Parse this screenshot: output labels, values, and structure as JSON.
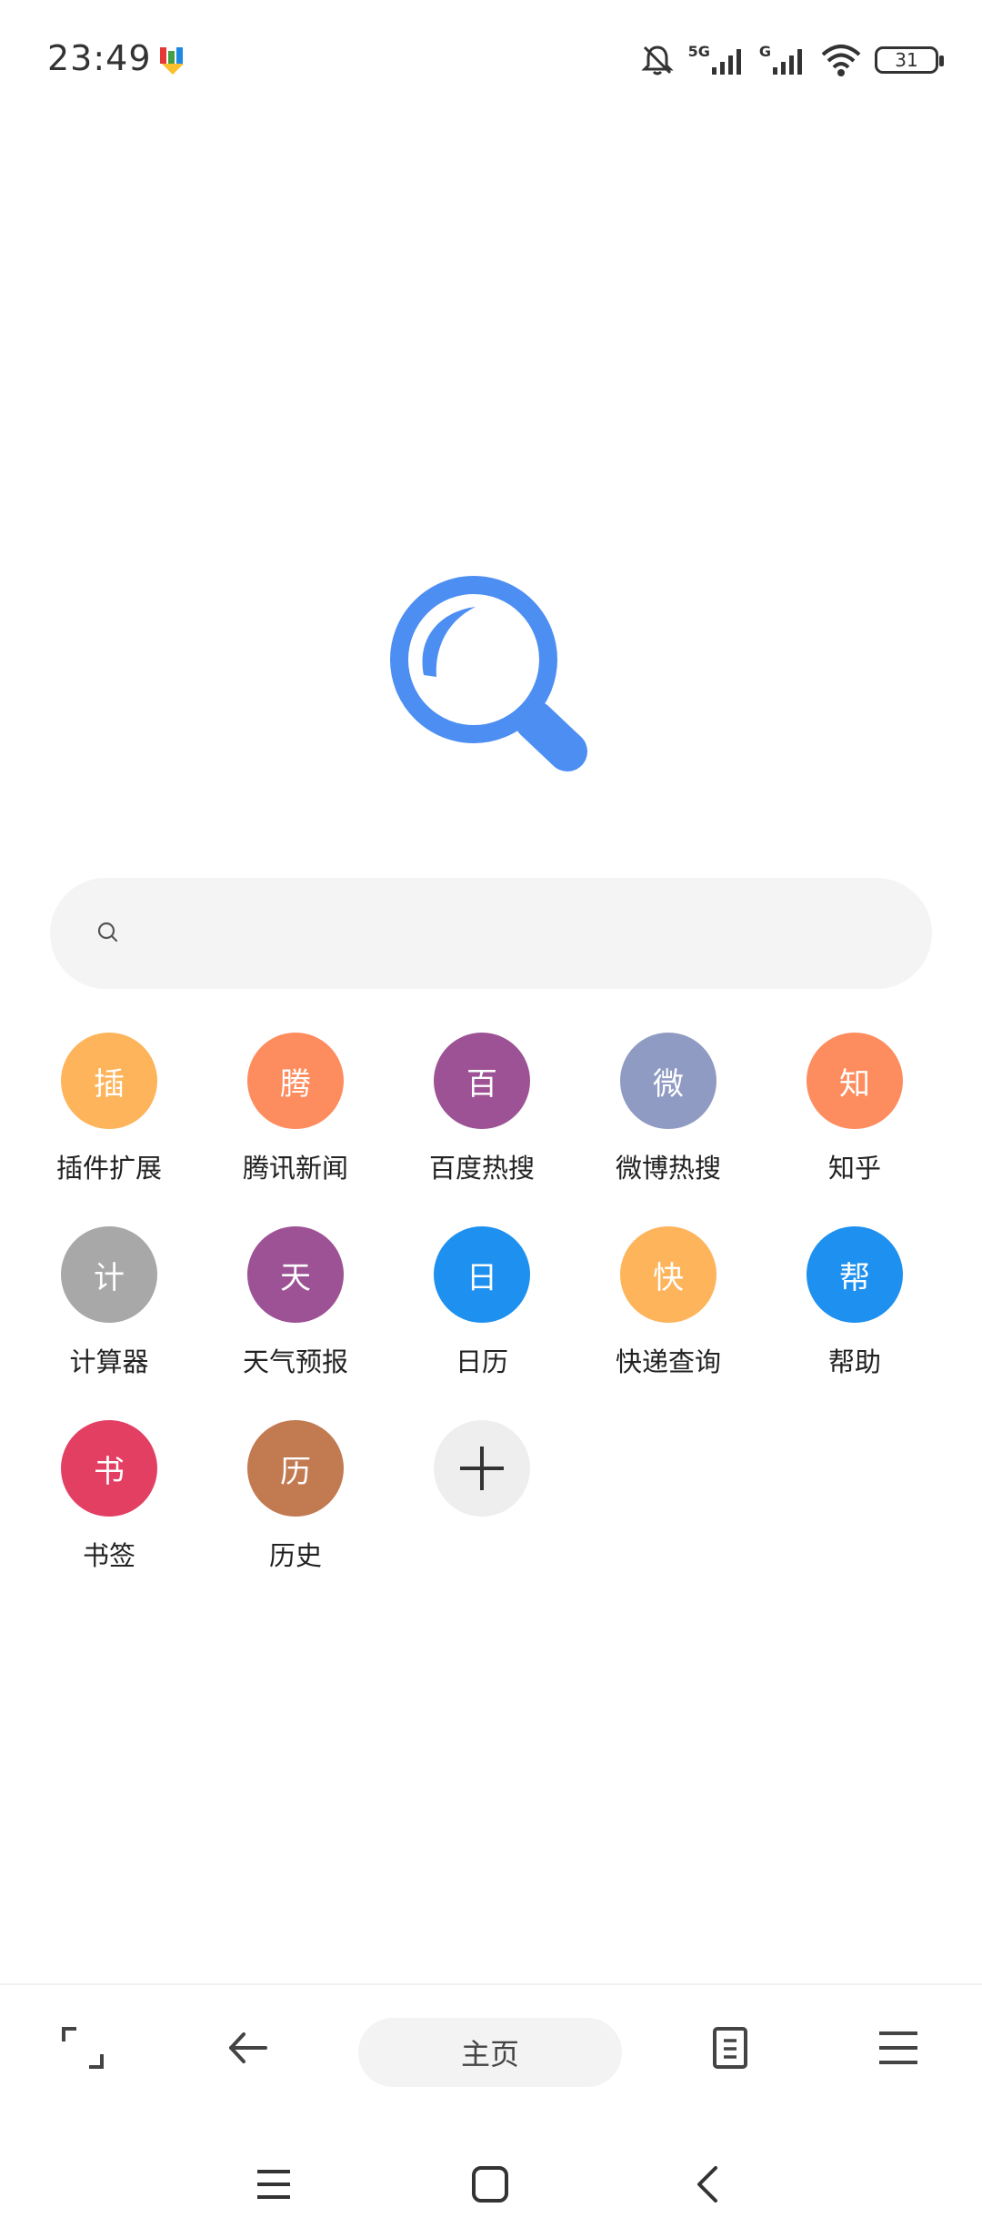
{
  "status_bar": {
    "time": "23:49",
    "network_label": "5G",
    "network2_label": "G",
    "battery": "31"
  },
  "search": {
    "placeholder": ""
  },
  "shortcuts": [
    {
      "icon_char": "插",
      "label": "插件扩展",
      "color": "#FDB45B"
    },
    {
      "icon_char": "腾",
      "label": "腾讯新闻",
      "color": "#FD8C5E"
    },
    {
      "icon_char": "百",
      "label": "百度热搜",
      "color": "#9C5295"
    },
    {
      "icon_char": "微",
      "label": "微博热搜",
      "color": "#8F9BC3"
    },
    {
      "icon_char": "知",
      "label": "知乎",
      "color": "#FD8C5E"
    },
    {
      "icon_char": "计",
      "label": "计算器",
      "color": "#A8A8A8"
    },
    {
      "icon_char": "天",
      "label": "天气预报",
      "color": "#9C5295"
    },
    {
      "icon_char": "日",
      "label": "日历",
      "color": "#1E90F0"
    },
    {
      "icon_char": "快",
      "label": "快递查询",
      "color": "#FDB45B"
    },
    {
      "icon_char": "帮",
      "label": "帮助",
      "color": "#1E90F0"
    },
    {
      "icon_char": "书",
      "label": "书签",
      "color": "#E33F63"
    },
    {
      "icon_char": "历",
      "label": "历史",
      "color": "#C27A51"
    }
  ],
  "add_shortcut": {
    "icon": "plus-icon"
  },
  "toolbar": {
    "home_label": "主页",
    "icons": [
      "fullscreen-icon",
      "back-arrow-icon",
      "tabs-icon",
      "menu-icon"
    ]
  },
  "nav_bar": {
    "icons": [
      "recent-apps-icon",
      "home-icon",
      "back-icon"
    ]
  },
  "colors": {
    "accent": "#4D8EF2",
    "search_bg": "#F4F4F4"
  }
}
